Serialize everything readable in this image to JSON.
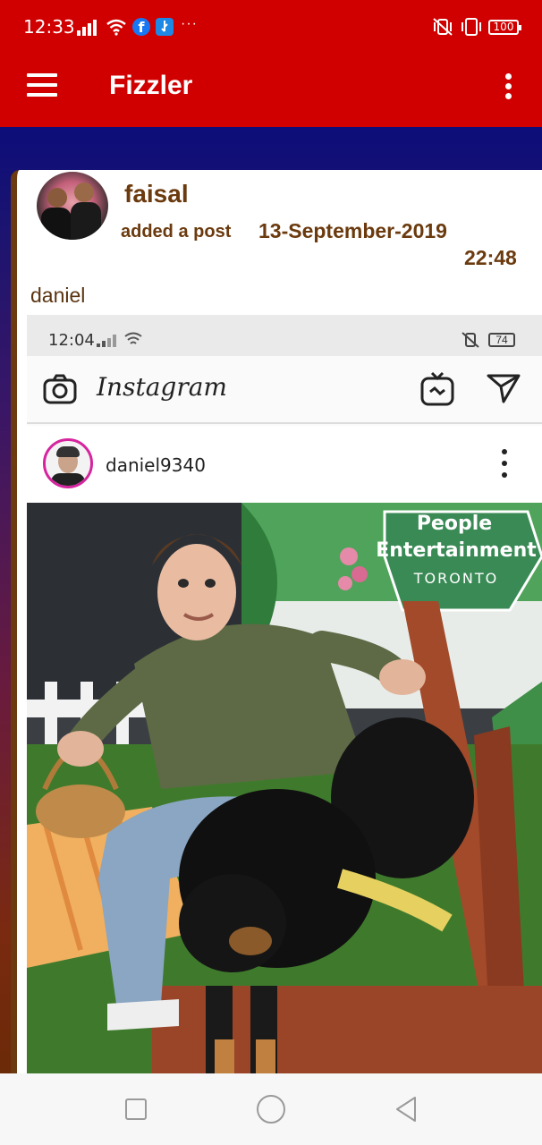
{
  "status_bar": {
    "time": "12:33",
    "battery": "100",
    "more_indicator": "···",
    "icons": [
      "signal-icon",
      "wifi-icon",
      "facebook-icon",
      "usb-icon",
      "vibrate-icon",
      "screen-rotation-icon",
      "battery-icon"
    ]
  },
  "app_bar": {
    "title": "Fizzler",
    "icons": [
      "hamburger-menu-icon",
      "overflow-menu-icon"
    ],
    "colors": {
      "primary": "#d10000"
    }
  },
  "post": {
    "username": "faisal",
    "action": "added a post",
    "date": "13-September-2019",
    "time": "22:48",
    "caption": "daniel",
    "colors": {
      "text": "#6b3a0e"
    }
  },
  "embedded_screenshot": {
    "status_time": "12:04",
    "status_battery": "74",
    "app_logo_text": "Instagram",
    "account_name": "daniel9340",
    "icons": [
      "camera-icon",
      "igtv-icon",
      "direct-send-icon",
      "more-vertical-icon"
    ],
    "photo_text": {
      "brand_line1": "People",
      "brand_line2": "Entertainment",
      "brand_line3": "TORONTO"
    }
  },
  "nav_bar": {
    "icons": [
      "recents-square-icon",
      "home-circle-icon",
      "back-triangle-icon"
    ]
  }
}
